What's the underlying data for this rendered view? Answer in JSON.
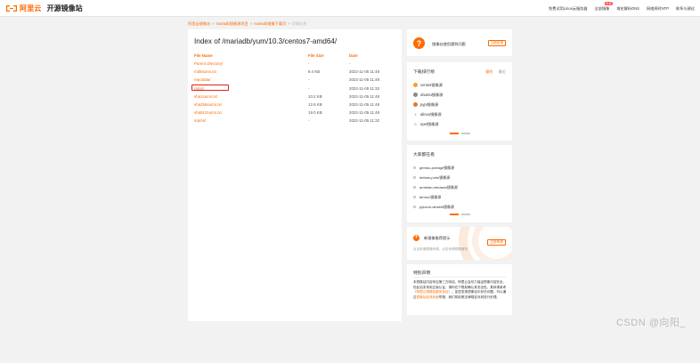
{
  "header": {
    "brand": "阿里云",
    "title": "开源镜像站",
    "nav": [
      "免费试用Linux云服务器",
      "全部镜像",
      "域名解析DNS",
      "网络授时NTP",
      "联系与建议"
    ],
    "nav_badge": "免费"
  },
  "breadcrumb": {
    "items": [
      "阿里云镜像站",
      "mariadb镜像源项目",
      "mariadb镜像下载页"
    ],
    "current": "详情信息",
    "separator": ">"
  },
  "listing": {
    "title": "Index of /mariadb/yum/10.3/centos7-amd64/",
    "headers": {
      "name": "File Name",
      "size": "File Size",
      "date": "Date"
    },
    "rows": [
      {
        "name": "Parent directory/",
        "size": "-",
        "date": "-"
      },
      {
        "name": "md5sums.txt",
        "size": "9.4 KB",
        "date": "2022-11-05 11:48"
      },
      {
        "name": "repodata/",
        "size": "-",
        "date": "2022-11-05 11:48"
      },
      {
        "name": "rpms/",
        "size": "-",
        "date": "2022-11-05 11:32"
      },
      {
        "name": "sha1sums.txt",
        "size": "10.2 KB",
        "date": "2022-11-05 11:48"
      },
      {
        "name": "sha256sums.txt",
        "size": "12.6 KB",
        "date": "2022-11-05 11:48"
      },
      {
        "name": "sha512sums.txt",
        "size": "19.0 KB",
        "date": "2022-11-05 11:48"
      },
      {
        "name": "srpms/",
        "size": "-",
        "date": "2022-11-05 11:32"
      }
    ]
  },
  "promo": {
    "text": "镜像站使用遇到问题",
    "button": "立即反馈"
  },
  "ranking": {
    "title": "下载排行榜",
    "tabs": [
      "操作",
      "最近"
    ],
    "items": [
      "centos镜像源",
      "ubuntu镜像源",
      "pypi镜像源",
      "alinux镜像源",
      "epel镜像源"
    ]
  },
  "favorites": {
    "title": "大家都在看",
    "items": [
      "gentoo-portage镜像源",
      "debian-ports镜像源",
      "armbian-releases镜像源",
      "termux镜像源",
      "pytorch-wheels镜像源"
    ]
  },
  "new_mirror": {
    "title": "新镜像推荐提示",
    "desc": "点击申请镜像申请，点击申请镜像服务",
    "button": "立即申请"
  },
  "notice": {
    "title": "特别声明",
    "body_1": "本镜像站内容来自第三方网站，阿里云会尽力保证镜像内容安全，但此站未采用正版认证。请你在下载前确认其安全性。具体请参考",
    "link_1": "《阿里云镜像站服务协议》",
    "body_2": "。如您发现镜像站中存在问题，可以通过",
    "link_2": "镜像站反馈页面",
    "body_3": "举报，我们将依照法律规定对其进行处理。"
  },
  "watermark": "CSDN @向阳_"
}
